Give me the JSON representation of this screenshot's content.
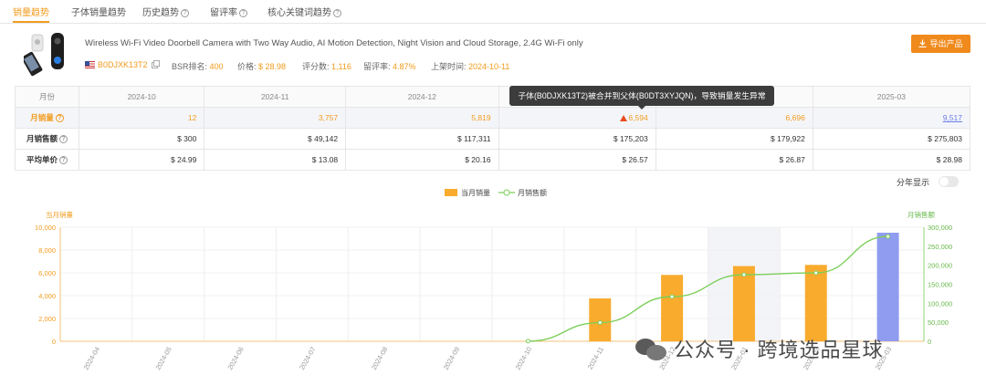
{
  "tabs": [
    {
      "label": "销量趋势",
      "active": true
    },
    {
      "label": "子体销量趋势",
      "active": false
    },
    {
      "label": "历史趋势",
      "active": false
    },
    {
      "label": "留评率",
      "active": false
    },
    {
      "label": "核心关键词趋势",
      "active": false
    }
  ],
  "product": {
    "title": "Wireless Wi-Fi Video Doorbell Camera with Two Way Audio, AI Motion Detection, Night Vision and Cloud Storage, 2.4G Wi-Fi only",
    "asin": "B0DJXK13T2",
    "bsr_label": "BSR排名:",
    "bsr_value": "400",
    "price_label": "价格:",
    "price_value": "$ 28.98",
    "reviews_label": "评分数:",
    "reviews_value": "1,116",
    "review_rate_label": "留评率:",
    "review_rate_value": "4.87%",
    "launch_label": "上架时间:",
    "launch_value": "2024-10-11"
  },
  "export_label": "导出产品",
  "table": {
    "header_label": "月份",
    "months": [
      "2024-10",
      "2024-11",
      "2024-12",
      "2025-01",
      "2025-02",
      "2025-03"
    ],
    "rows": [
      {
        "label": "月销量",
        "values": [
          "12",
          "3,757",
          "5,819",
          "6,594",
          "6,696",
          "9,517"
        ]
      },
      {
        "label": "月销售额",
        "values": [
          "$ 300",
          "$ 49,142",
          "$ 117,311",
          "$ 175,203",
          "$ 179,922",
          "$ 275,803"
        ]
      },
      {
        "label": "平均单价",
        "values": [
          "$ 24.99",
          "$ 13.08",
          "$ 20.16",
          "$ 26.57",
          "$ 26.87",
          "$ 28.98"
        ]
      }
    ]
  },
  "tooltip": "子体(B0DJXK13T2)被合并到父体(B0DT3XYJQN)，导致销量发生异常",
  "toggle_label": "分年显示",
  "watermark": "公众号 · 跨境选品星球",
  "colors": {
    "accent": "#f29b1d",
    "bar": "#f9ab2e",
    "bar_highlight": "#8f9cf0",
    "line": "#7ccf5a"
  },
  "chart_data": {
    "type": "bar",
    "categories": [
      "2024-04",
      "2024-05",
      "2024-06",
      "2024-07",
      "2024-08",
      "2024-09",
      "2024-10",
      "2024-11",
      "2024-12",
      "2025-01",
      "2025-02",
      "2025-03"
    ],
    "series": [
      {
        "name": "当月销量",
        "type": "bar",
        "axis": "left",
        "values": [
          0,
          0,
          0,
          0,
          0,
          0,
          12,
          3757,
          5819,
          6594,
          6696,
          9517
        ]
      },
      {
        "name": "月销售额",
        "type": "line",
        "axis": "right",
        "values": [
          0,
          0,
          0,
          0,
          0,
          0,
          300,
          49142,
          117311,
          175203,
          179922,
          275803
        ]
      }
    ],
    "ylabel_left": "当月销量",
    "ylabel_right": "月销售额",
    "ylim_left": [
      0,
      10000
    ],
    "ylim_right": [
      0,
      300000
    ],
    "yticks_left": [
      "0",
      "2,000",
      "4,000",
      "6,000",
      "8,000",
      "10,000"
    ],
    "yticks_right": [
      "0",
      "50,000",
      "100,000",
      "150,000",
      "200,000",
      "250,000",
      "300,000"
    ],
    "highlight_category": "2025-01",
    "highlight_bar": "2025-03",
    "legend_position": "top-center",
    "grid": true
  }
}
